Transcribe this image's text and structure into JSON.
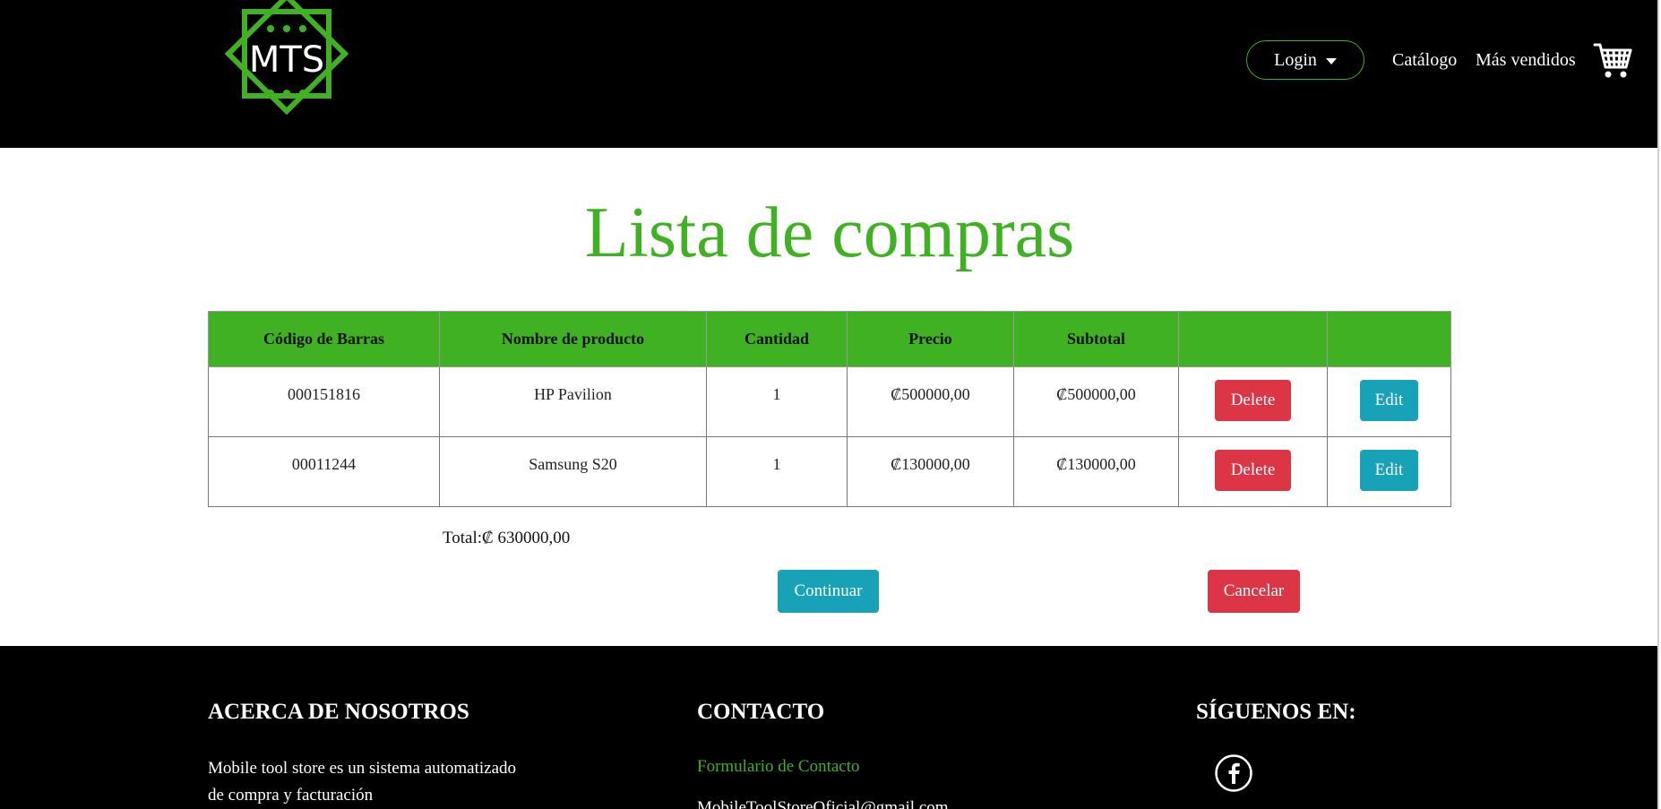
{
  "header": {
    "logo_text": "MTS",
    "login_label": "Login",
    "nav": {
      "catalog": "Catálogo",
      "bestsellers": "Más vendidos"
    }
  },
  "page_title": "Lista de compras",
  "table": {
    "headers": [
      "Código de Barras",
      "Nombre de producto",
      "Cantidad",
      "Precio",
      "Subtotal",
      "",
      ""
    ],
    "rows": [
      {
        "code": "000151816",
        "name": "HP Pavilion",
        "qty": "1",
        "price": "₡500000,00",
        "subtotal": "₡500000,00",
        "delete": "Delete",
        "edit": "Edit"
      },
      {
        "code": "00011244",
        "name": "Samsung S20",
        "qty": "1",
        "price": "₡130000,00",
        "subtotal": "₡130000,00",
        "delete": "Delete",
        "edit": "Edit"
      }
    ]
  },
  "total": "Total:₡ 630000,00",
  "actions": {
    "continue": "Continuar",
    "cancel": "Cancelar"
  },
  "footer": {
    "about_title": "ACERCA DE NOSOTROS",
    "about_text": "Mobile tool store es un sistema automatizado de compra y facturación",
    "contact_title": "CONTACTO",
    "contact_link": "Formulario de Contacto",
    "contact_email": "MobileToolStoreOficial@gmail.com",
    "follow_title": "SÍGUENOS EN:",
    "social_icon": "facebook-icon"
  },
  "colors": {
    "accent": "#41b124",
    "danger": "#dc3545",
    "info": "#17a2b8",
    "header_bg": "#000000"
  }
}
